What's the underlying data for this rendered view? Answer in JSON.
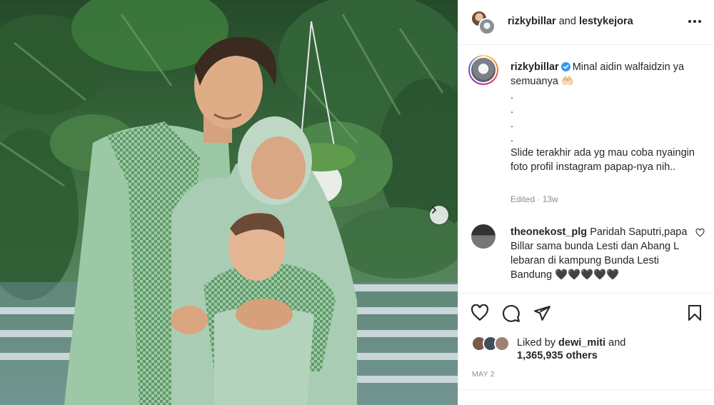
{
  "header": {
    "user1": "rizkybillar",
    "joiner": " and ",
    "user2": "lestykejora",
    "more_icon": "more-horizontal-icon"
  },
  "caption": {
    "username": "rizkybillar",
    "line1": "Minal aidin walfaidzin ya semuanya 🤲🏻",
    "dot1": ".",
    "dot2": ".",
    "dot3": ".",
    "dot4": ".",
    "body": "Slide terakhir ada yg mau coba nyaingin foto profil instagram papap-nya nih..",
    "edited": "Edited",
    "sep": " · ",
    "age": "13w"
  },
  "comment": {
    "username": "theonekost_plg",
    "text": "Paridah Saputri,papa Billar sama bunda Lesti dan Abang L lebaran di kampung Bunda Lesti Bandung 🖤🖤🖤🖤🖤"
  },
  "likes": {
    "prefix": "Liked by ",
    "user": "dewi_miti",
    "suffix": " and",
    "count": "1,365,935 others"
  },
  "date": "MAY 2",
  "colors": {
    "verified": "#3897f0",
    "text": "#262626",
    "muted": "#8e8e8e",
    "border": "#efefef"
  }
}
